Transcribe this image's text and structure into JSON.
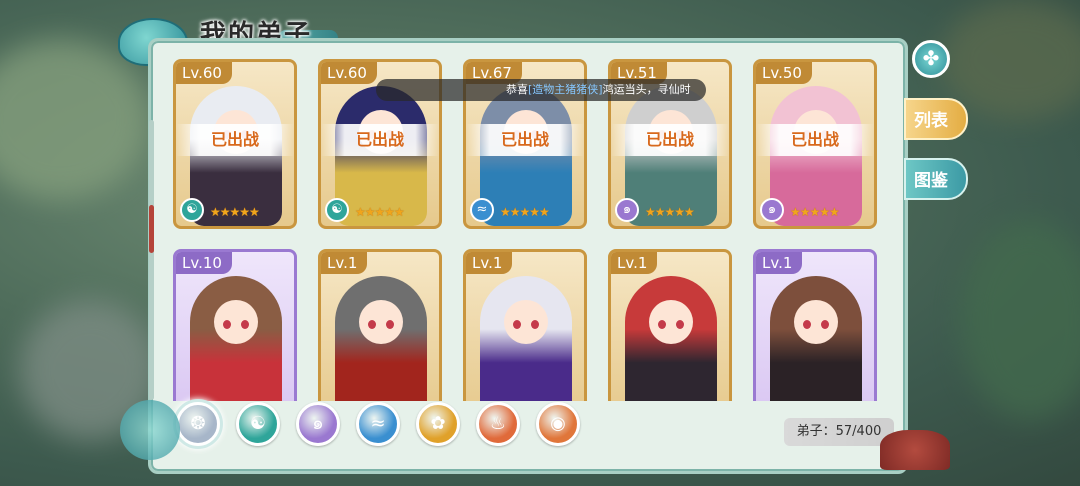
{
  "title": "我的弟子",
  "notice": {
    "prefix": "恭喜",
    "highlight": "[造物主猪猪侠]",
    "suffix": "鸿运当头，寻仙时"
  },
  "cards": [
    {
      "level": "Lv.60",
      "status": "已出战",
      "frame": "gold",
      "stars": "★★★★★",
      "element_icon": "yin-yang-icon",
      "element_color": "#2fa59a",
      "hair": "#e9ecf2",
      "outfit": "#3a2e3f"
    },
    {
      "level": "Lv.60",
      "status": "已出战",
      "frame": "gold",
      "stars": "★★★★★",
      "element_icon": "yin-yang-icon",
      "element_color": "#2fa59a",
      "hair": "#2b2b6b",
      "outfit": "#d8b84a"
    },
    {
      "level": "Lv.67",
      "status": "已出战",
      "frame": "gold",
      "stars": "★★★★★",
      "element_icon": "water-wave-icon",
      "element_color": "#3a8fd0",
      "hair": "#7d8ea8",
      "outfit": "#2d7fb6"
    },
    {
      "level": "Lv.51",
      "status": "已出战",
      "frame": "gold",
      "stars": "★★★★★",
      "element_icon": "wind-swirl-icon",
      "element_color": "#9a78d0",
      "hair": "#cfcfcf",
      "outfit": "#4f7f78"
    },
    {
      "level": "Lv.50",
      "status": "已出战",
      "frame": "gold",
      "stars": "★★★★★",
      "element_icon": "wind-swirl-icon",
      "element_color": "#9a78d0",
      "hair": "#f2c2d3",
      "outfit": "#d76a9b"
    },
    {
      "level": "Lv.10",
      "status": "",
      "frame": "purple",
      "stars": "",
      "element_icon": "",
      "element_color": "",
      "hair": "#8a5d44",
      "outfit": "#c8323a"
    },
    {
      "level": "Lv.1",
      "status": "",
      "frame": "gold",
      "stars": "",
      "element_icon": "",
      "element_color": "",
      "hair": "#6f6f6f",
      "outfit": "#a2251d"
    },
    {
      "level": "Lv.1",
      "status": "",
      "frame": "gold",
      "stars": "",
      "element_icon": "",
      "element_color": "",
      "hair": "#e6e6f0",
      "outfit": "#4a2b8a"
    },
    {
      "level": "Lv.1",
      "status": "",
      "frame": "gold",
      "stars": "",
      "element_icon": "",
      "element_color": "",
      "hair": "#c73a3a",
      "outfit": "#2e2630"
    },
    {
      "level": "Lv.1",
      "status": "",
      "frame": "purple",
      "stars": "",
      "element_icon": "",
      "element_color": "",
      "hair": "#7d4f3c",
      "outfit": "#2b2226"
    }
  ],
  "side_tabs": [
    {
      "label": "列表",
      "active": true
    },
    {
      "label": "图鉴",
      "active": false
    }
  ],
  "filters": [
    {
      "icon": "all-swirl-icon",
      "color": "#a7b6c9",
      "glyph": "❂",
      "selected": true
    },
    {
      "icon": "yin-yang-icon",
      "color": "#2fa59a",
      "glyph": "☯",
      "selected": false
    },
    {
      "icon": "wind-swirl-icon",
      "color": "#9a78d0",
      "glyph": "๑",
      "selected": false
    },
    {
      "icon": "water-wave-icon",
      "color": "#3a8fd0",
      "glyph": "≈",
      "selected": false
    },
    {
      "icon": "lotus-icon",
      "color": "#e0a12a",
      "glyph": "✿",
      "selected": false
    },
    {
      "icon": "flame-icon",
      "color": "#e06a3a",
      "glyph": "♨",
      "selected": false
    },
    {
      "icon": "eye-icon",
      "color": "#e0763a",
      "glyph": "◉",
      "selected": false
    }
  ],
  "disciple_count": "弟子：57/400",
  "close_icon": "close-clover-icon"
}
